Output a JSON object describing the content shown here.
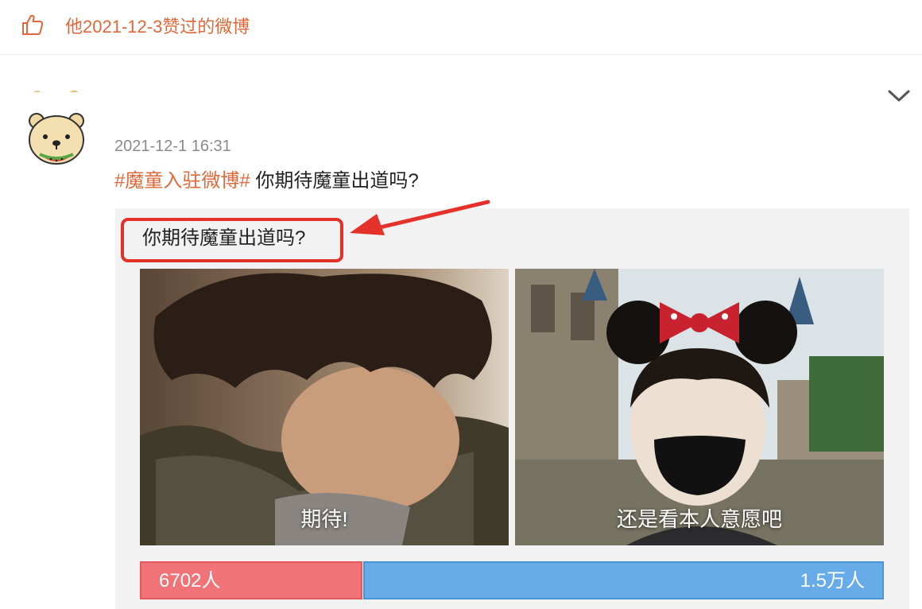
{
  "liked_bar": {
    "icon": "thumbs-up-icon",
    "text": "他2021-12-3赞过的微博"
  },
  "post": {
    "avatar": "bear-avatar",
    "time": "2021-12-1 16:31",
    "hashtag": "#魔童入驻微博#",
    "text": " 你期待魔童出道吗?",
    "menu_icon": "chevron-down-icon"
  },
  "poll": {
    "title": "你期待魔童出道吗?",
    "options": [
      {
        "label": "期待!",
        "votes": "6702人",
        "share": 0.3
      },
      {
        "label": "还是看本人意愿吧",
        "votes": "1.5万人",
        "share": 0.7
      }
    ]
  },
  "colors": {
    "accent": "#e0683a",
    "highlight_red": "#e4322b",
    "vote_a": "#f07378",
    "vote_b": "#67abe8"
  }
}
